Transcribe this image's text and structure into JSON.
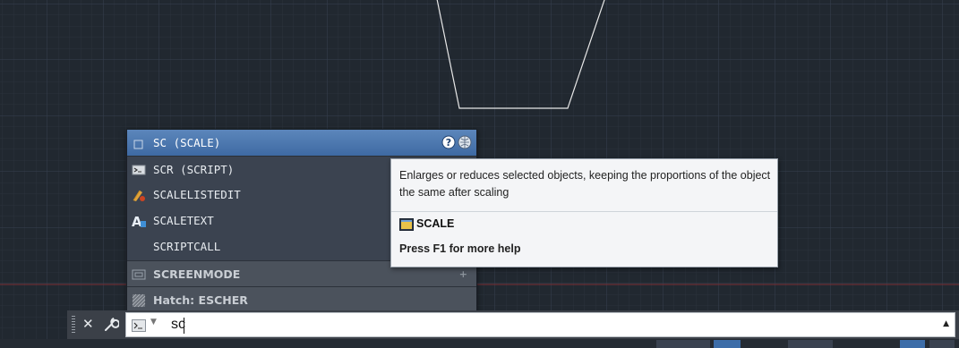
{
  "autocomplete": {
    "items": [
      {
        "label": "SC (SCALE)",
        "icon": "scale-icon",
        "selected": true
      },
      {
        "label": "SCR (SCRIPT)",
        "icon": "script-icon"
      },
      {
        "label": "SCALELISTEDIT",
        "icon": "scalelistedit-icon"
      },
      {
        "label": "SCALETEXT",
        "icon": "scaletext-icon"
      },
      {
        "label": "SCRIPTCALL",
        "icon": ""
      }
    ],
    "categories": [
      {
        "label": "SCREENMODE",
        "icon": "system-variable-icon"
      },
      {
        "label": "Hatch: ESCHER",
        "icon": "hatch-icon"
      }
    ]
  },
  "tooltip": {
    "description": "Enlarges or reduces selected objects, keeping the proportions of the object the same after scaling",
    "command": "SCALE",
    "help": "Press F1 for more help"
  },
  "command_line": {
    "value": "sc"
  },
  "colors": {
    "canvas": "#212830",
    "selected_row": "#4a77b0",
    "tooltip_bg": "#f4f5f7"
  }
}
